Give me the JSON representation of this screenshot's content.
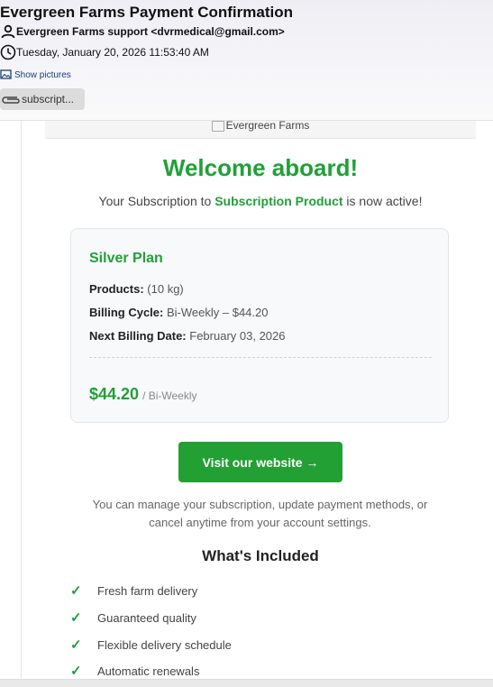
{
  "email": {
    "subject": "Evergreen Farms Payment Confirmation",
    "sender": "Evergreen Farms support <dvrmedical@gmail.com>",
    "date": "Tuesday, January 20, 2026 11:53:40 AM",
    "show_pictures": "Show pictures",
    "attachment": "subscript..."
  },
  "banner": {
    "alt": "Evergreen Farms"
  },
  "welcome": {
    "title": "Welcome aboard!",
    "sub_prefix": "Your Subscription to ",
    "product": "Subscription Product",
    "sub_suffix": " is now active!"
  },
  "card": {
    "plan": "Silver Plan",
    "products_label": "Products:",
    "products_value": "(10 kg)",
    "billing_label": "Billing Cycle:",
    "billing_value": "Bi-Weekly – $44.20",
    "next_label": "Next Billing Date:",
    "next_value": "February 03, 2026",
    "price": "$44.20",
    "period": "/ Bi-Weekly"
  },
  "cta": {
    "label": "Visit our website →"
  },
  "manage_text": "You can manage your subscription, update payment methods, or cancel anytime from your account settings.",
  "included": {
    "title": "What's Included",
    "check": "✓",
    "items": [
      "Fresh farm delivery",
      "Guaranteed quality",
      "Flexible delivery schedule",
      "Automatic renewals"
    ]
  },
  "colors": {
    "accent": "#21a038",
    "button": "#22a033"
  },
  "icons": {
    "sender": "person-icon",
    "date": "clock-icon",
    "pictures": "image-icon",
    "attachment": "paperclip-icon"
  }
}
